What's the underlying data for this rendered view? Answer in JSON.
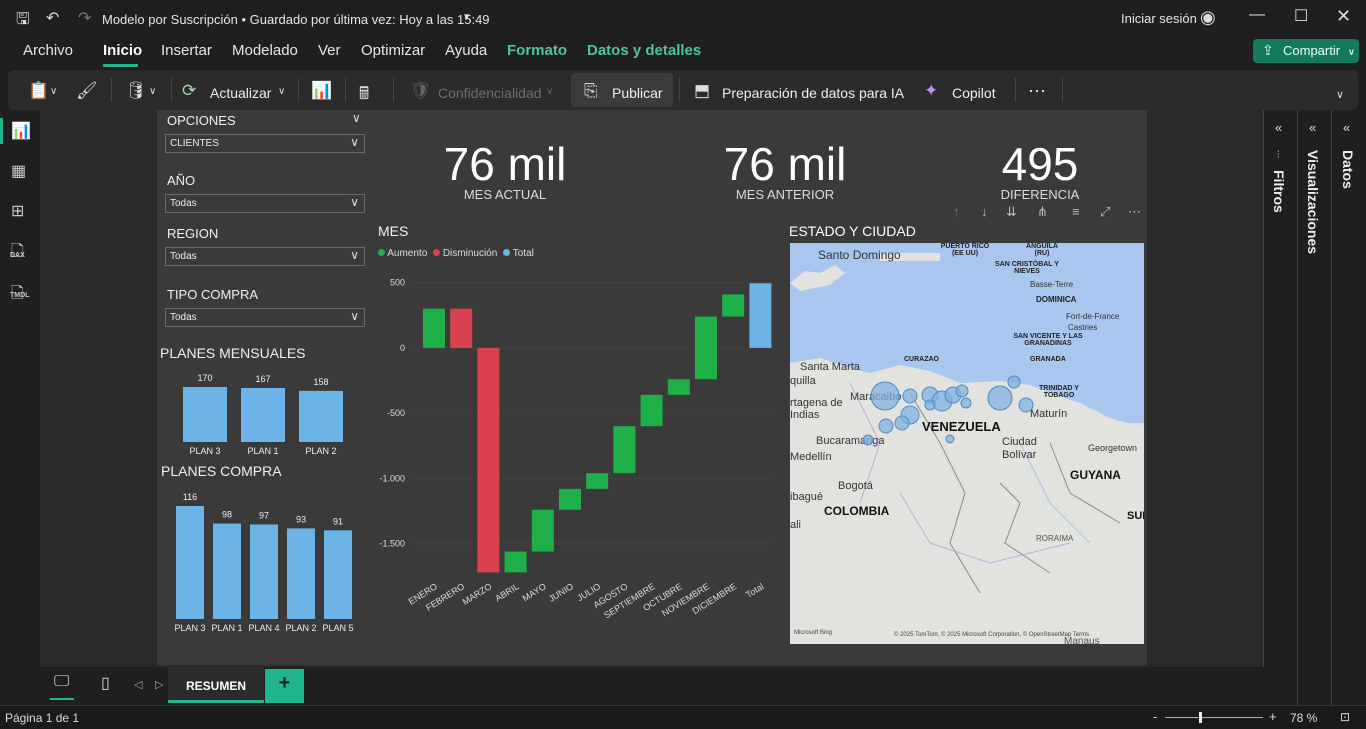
{
  "titlebar": {
    "title": "Modelo por Suscripción • Guardado por última vez: Hoy a las 15:49",
    "signin": "Iniciar sesión"
  },
  "menu": {
    "tabs": [
      "Archivo",
      "Inicio",
      "Insertar",
      "Modelado",
      "Ver",
      "Optimizar",
      "Ayuda",
      "Formato",
      "Datos y detalles"
    ],
    "active": "Inicio",
    "share": "Compartir"
  },
  "ribbon": {
    "refresh": "Actualizar",
    "sensitivity": "Confidencialidad",
    "publish": "Publicar",
    "ai_prep": "Preparación de datos para IA",
    "copilot": "Copilot",
    "more": "···"
  },
  "leftnav": {
    "dax_label": "DAX",
    "tmdl_label": "TMDL"
  },
  "slicers": {
    "opciones": {
      "title": "OPCIONES",
      "value": "CLIENTES"
    },
    "anio": {
      "title": "AÑO",
      "value": "Todas"
    },
    "region": {
      "title": "REGION",
      "value": "Todas"
    },
    "tipo": {
      "title": "TIPO COMPRA",
      "value": "Todas"
    }
  },
  "kpis": {
    "actual": {
      "value": "76 mil",
      "label": "MES ACTUAL"
    },
    "anterior": {
      "value": "76 mil",
      "label": "MES ANTERIOR"
    },
    "diferencia": {
      "value": "495",
      "label": "DIFERENCIA"
    }
  },
  "chart_data": [
    {
      "type": "bar",
      "title": "PLANES MENSUALES",
      "categories": [
        "PLAN 3",
        "PLAN 1",
        "PLAN 2"
      ],
      "values": [
        170,
        167,
        158
      ],
      "color": "#6cb4e8"
    },
    {
      "type": "bar",
      "title": "PLANES COMPRA",
      "categories": [
        "PLAN 3",
        "PLAN 1",
        "PLAN 4",
        "PLAN 2",
        "PLAN 5"
      ],
      "values": [
        116,
        98,
        97,
        93,
        91
      ],
      "color": "#6cb4e8"
    },
    {
      "type": "bar",
      "subtype": "waterfall",
      "title": "MES",
      "legend": [
        {
          "name": "Aumento",
          "color": "#1fb04a"
        },
        {
          "name": "Disminución",
          "color": "#d9414e"
        },
        {
          "name": "Total",
          "color": "#6cb4e8"
        }
      ],
      "categories": [
        "ENERO",
        "FEBRERO",
        "MARZO",
        "ABRIL",
        "MAYO",
        "JUNIO",
        "JULIO",
        "AGOSTO",
        "SEPTIEMBRE",
        "OCTUBRE",
        "NOVIEMBRE",
        "DICIEMBRE",
        "Total"
      ],
      "deltas": [
        300,
        -300,
        -1720,
        160,
        320,
        160,
        120,
        360,
        240,
        120,
        480,
        170,
        495
      ],
      "yticks": [
        "500",
        "0",
        "-500",
        "-1.000",
        "-1.500"
      ],
      "ytick_values": [
        500,
        0,
        -500,
        -1000,
        -1500
      ],
      "ylim": [
        -1740,
        520
      ]
    }
  ],
  "map": {
    "title": "ESTADO Y CIUDAD",
    "labels": {
      "santo_domingo": "Santo Domingo",
      "puerto_rico": "PUERTO RICO (EE UU)",
      "anguila": "ANGUILA (RU)",
      "san_cristobal": "SAN CRISTÓBAL Y NIEVES",
      "basse_terre": "Basse-Terre",
      "dominica": "DOMINICA",
      "fort_de_france": "Fort-de-France",
      "castries": "Castries",
      "san_vicente": "SAN VICENTE Y LAS GRANADINAS",
      "granada": "GRANADA",
      "curazao": "CURAZAO",
      "santa_marta": "Santa Marta",
      "barranquilla": "quilla",
      "cartagena": "rtagena de Indias",
      "maracaibo": "Maracaibo",
      "trinidad": "TRINIDAD Y TOBAGO",
      "maturin": "Maturín",
      "bucaramanga": "Bucaramanga",
      "venezuela": "VENEZUELA",
      "medellin": "Medellín",
      "ciudad_bolivar": "Ciudad Bolívar",
      "georgetown": "Georgetown",
      "bogota": "Bogotá",
      "guyana": "GUYANA",
      "colombia": "COLOMBIA",
      "ibague": "ibagué",
      "suriname": "SUI",
      "roraima": "RORAIMA",
      "manaus": "Manaus",
      "cali": "ali",
      "bing": "Microsoft Bing",
      "attribution": "© 2025 TomTom, © 2025 Microsoft Corporation, © OpenStreetMap  Terms"
    }
  },
  "panes": {
    "filters": "Filtros",
    "visualizations": "Visualizaciones",
    "data": "Datos"
  },
  "pages": {
    "tab": "RESUMEN",
    "add": "+"
  },
  "status": {
    "page": "Página 1 de 1",
    "zoom": "78 %"
  }
}
